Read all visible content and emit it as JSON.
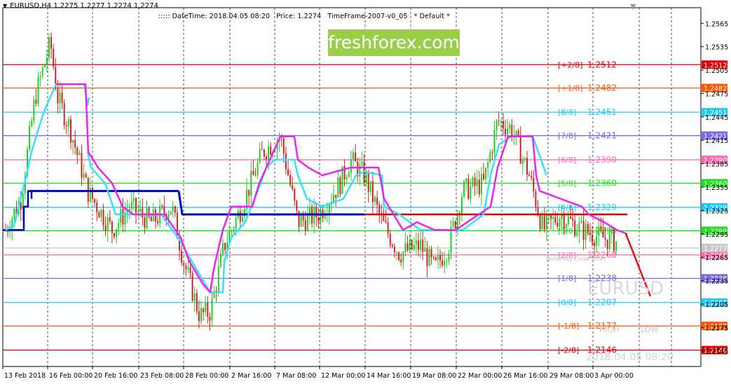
{
  "header": {
    "symbol_line": "EURUSD,H4  1.2275 1.2277 1.2274 1.2274",
    "datetime": "::::: DateTime: 2018.04.05 08:20",
    "price": "Price: 1.2274",
    "timeframe": "TimeFrame-2007-v0_05",
    "default": "*  Default  *",
    "corner_marker": "▼"
  },
  "brand": "freshforex.com",
  "colors": {
    "grid": "#000000",
    "bull_candle": "#22cc22",
    "bear_candle": "#cc2222",
    "cyan_line": "#33e0ff",
    "magenta_line": "#ee22ee",
    "blue_line": "#0000cc",
    "red_line": "#dd0000",
    "forecast": "#ee1111"
  },
  "chart_data": {
    "type": "candlestick",
    "symbol": "EURUSD",
    "timeframe": "H4",
    "ylim": [
      1.2125,
      1.2585
    ],
    "price_ticks": [
      "1.2565",
      "1.2535",
      "1.2505",
      "1.2475",
      "1.2445",
      "1.2415",
      "1.2385",
      "1.2355",
      "1.2325",
      "1.2295",
      "1.2265",
      "1.2235",
      "1.2205",
      "1.2175",
      "1.2145"
    ],
    "time_labels": [
      "13 Feb 2018",
      "16 Feb 00:00",
      "20 Feb 16:00",
      "23 Feb 08:00",
      "28 Feb 00:00",
      "2 Mar 16:00",
      "7 Mar 08:00",
      "12 Mar 00:00",
      "14 Mar 16:00",
      "19 Mar 08:00",
      "22 Mar 00:00",
      "26 Mar 16:00",
      "29 Mar 08:00",
      "3 Apr 00:00"
    ],
    "murrey_levels": [
      {
        "label": "[+2/8]",
        "value": "1.2512",
        "price": 1.2512,
        "color": "#dd0000"
      },
      {
        "label": "[+1/8]",
        "value": "1.2482",
        "price": 1.2482,
        "color": "#ff5500"
      },
      {
        "label": "[8/8]",
        "value": "1.2451",
        "price": 1.2451,
        "color": "#22c8f0"
      },
      {
        "label": "[7/8]",
        "value": "1.2421",
        "price": 1.2421,
        "color": "#7b68ee"
      },
      {
        "label": "[6/8]",
        "value": "1.2390",
        "price": 1.239,
        "color": "#ff69b4"
      },
      {
        "label": "[5/8]",
        "value": "1.2360",
        "price": 1.236,
        "color": "#22dd22"
      },
      {
        "label": "[4/8]",
        "value": "1.2329",
        "price": 1.2329,
        "color": "#22c8f0"
      },
      {
        "label": "[3/8]",
        "value": "1.2299",
        "price": 1.2299,
        "color": "#22dd22"
      },
      {
        "label": "[2/8]",
        "value": "1.2268",
        "price": 1.2268,
        "color": "#ff69b4"
      },
      {
        "label": "[1/8]",
        "value": "1.2238",
        "price": 1.2238,
        "color": "#7b68ee"
      },
      {
        "label": "[0/8]",
        "value": "1.2207",
        "price": 1.2207,
        "color": "#22c8f0"
      },
      {
        "label": "[-1/8]",
        "value": "1.2177",
        "price": 1.2177,
        "color": "#ff5500"
      },
      {
        "label": "[-2/8]",
        "value": "1.2146",
        "price": 1.2146,
        "color": "#dd0000"
      }
    ],
    "current_price": {
      "value": "1.2277",
      "price": 1.2277
    },
    "watermark_symbol": "EURUSD",
    "watermark_datetime": "2018.04.05 08:20",
    "yesterday_label": "Yesterday Close HIGH",
    "high_label": "HIGH",
    "low_label": "LOW",
    "series": [
      {
        "name": "cyan",
        "t": [
          0,
          2,
          6,
          15,
          20,
          40,
          45,
          47,
          60,
          65,
          75,
          90,
          105,
          115,
          120,
          130,
          138,
          143,
          147,
          155,
          160,
          165,
          170,
          178,
          185,
          195,
          200,
          205,
          208,
          210,
          215,
          222,
          230,
          238,
          244,
          250
        ],
        "v": [
          1.23,
          1.23,
          1.232,
          1.242,
          1.246,
          1.2487,
          1.2487,
          1.2487,
          1.2487,
          1.2487,
          1.2487,
          1.2487,
          1.2487,
          1.2487,
          1.2487,
          1.2487,
          1.2487,
          1.2487,
          1.2487,
          1.2487,
          1.2487,
          1.2487,
          1.2487,
          1.2487,
          1.2487,
          1.2487,
          1.2487,
          1.2487,
          1.2487,
          1.2487,
          1.2487,
          1.2487,
          1.2487,
          1.2487,
          1.2487,
          1.2487
        ]
      },
      {
        "name": "cyan2",
        "t": [
          0,
          5,
          10,
          15,
          20,
          28,
          34,
          40,
          48,
          52,
          56,
          60,
          66,
          72,
          78,
          84,
          90,
          96,
          102,
          108,
          114,
          120,
          126,
          132,
          138,
          144,
          150,
          156,
          162,
          168,
          172,
          178,
          184,
          190,
          196,
          202,
          208,
          214,
          220,
          226,
          232,
          238,
          244,
          250
        ],
        "v": [
          1.23,
          1.231,
          1.233,
          1.242,
          1.246,
          1.2487,
          1.2487,
          1.2487,
          1.2487,
          1.2487,
          1.2487,
          1.2487,
          1.2487,
          1.2487,
          1.2487,
          1.2487,
          1.2487,
          1.2487,
          1.2487,
          1.2487,
          1.2487,
          1.2487,
          1.2487,
          1.2487,
          1.2487,
          1.2487,
          1.2487,
          1.2487,
          1.2487,
          1.2487,
          1.2487,
          1.2487,
          1.2487,
          1.2487,
          1.2487,
          1.2487,
          1.2487,
          1.2487,
          1.2487,
          1.2487,
          1.2487,
          1.2487,
          1.2487,
          1.2487
        ]
      }
    ]
  }
}
